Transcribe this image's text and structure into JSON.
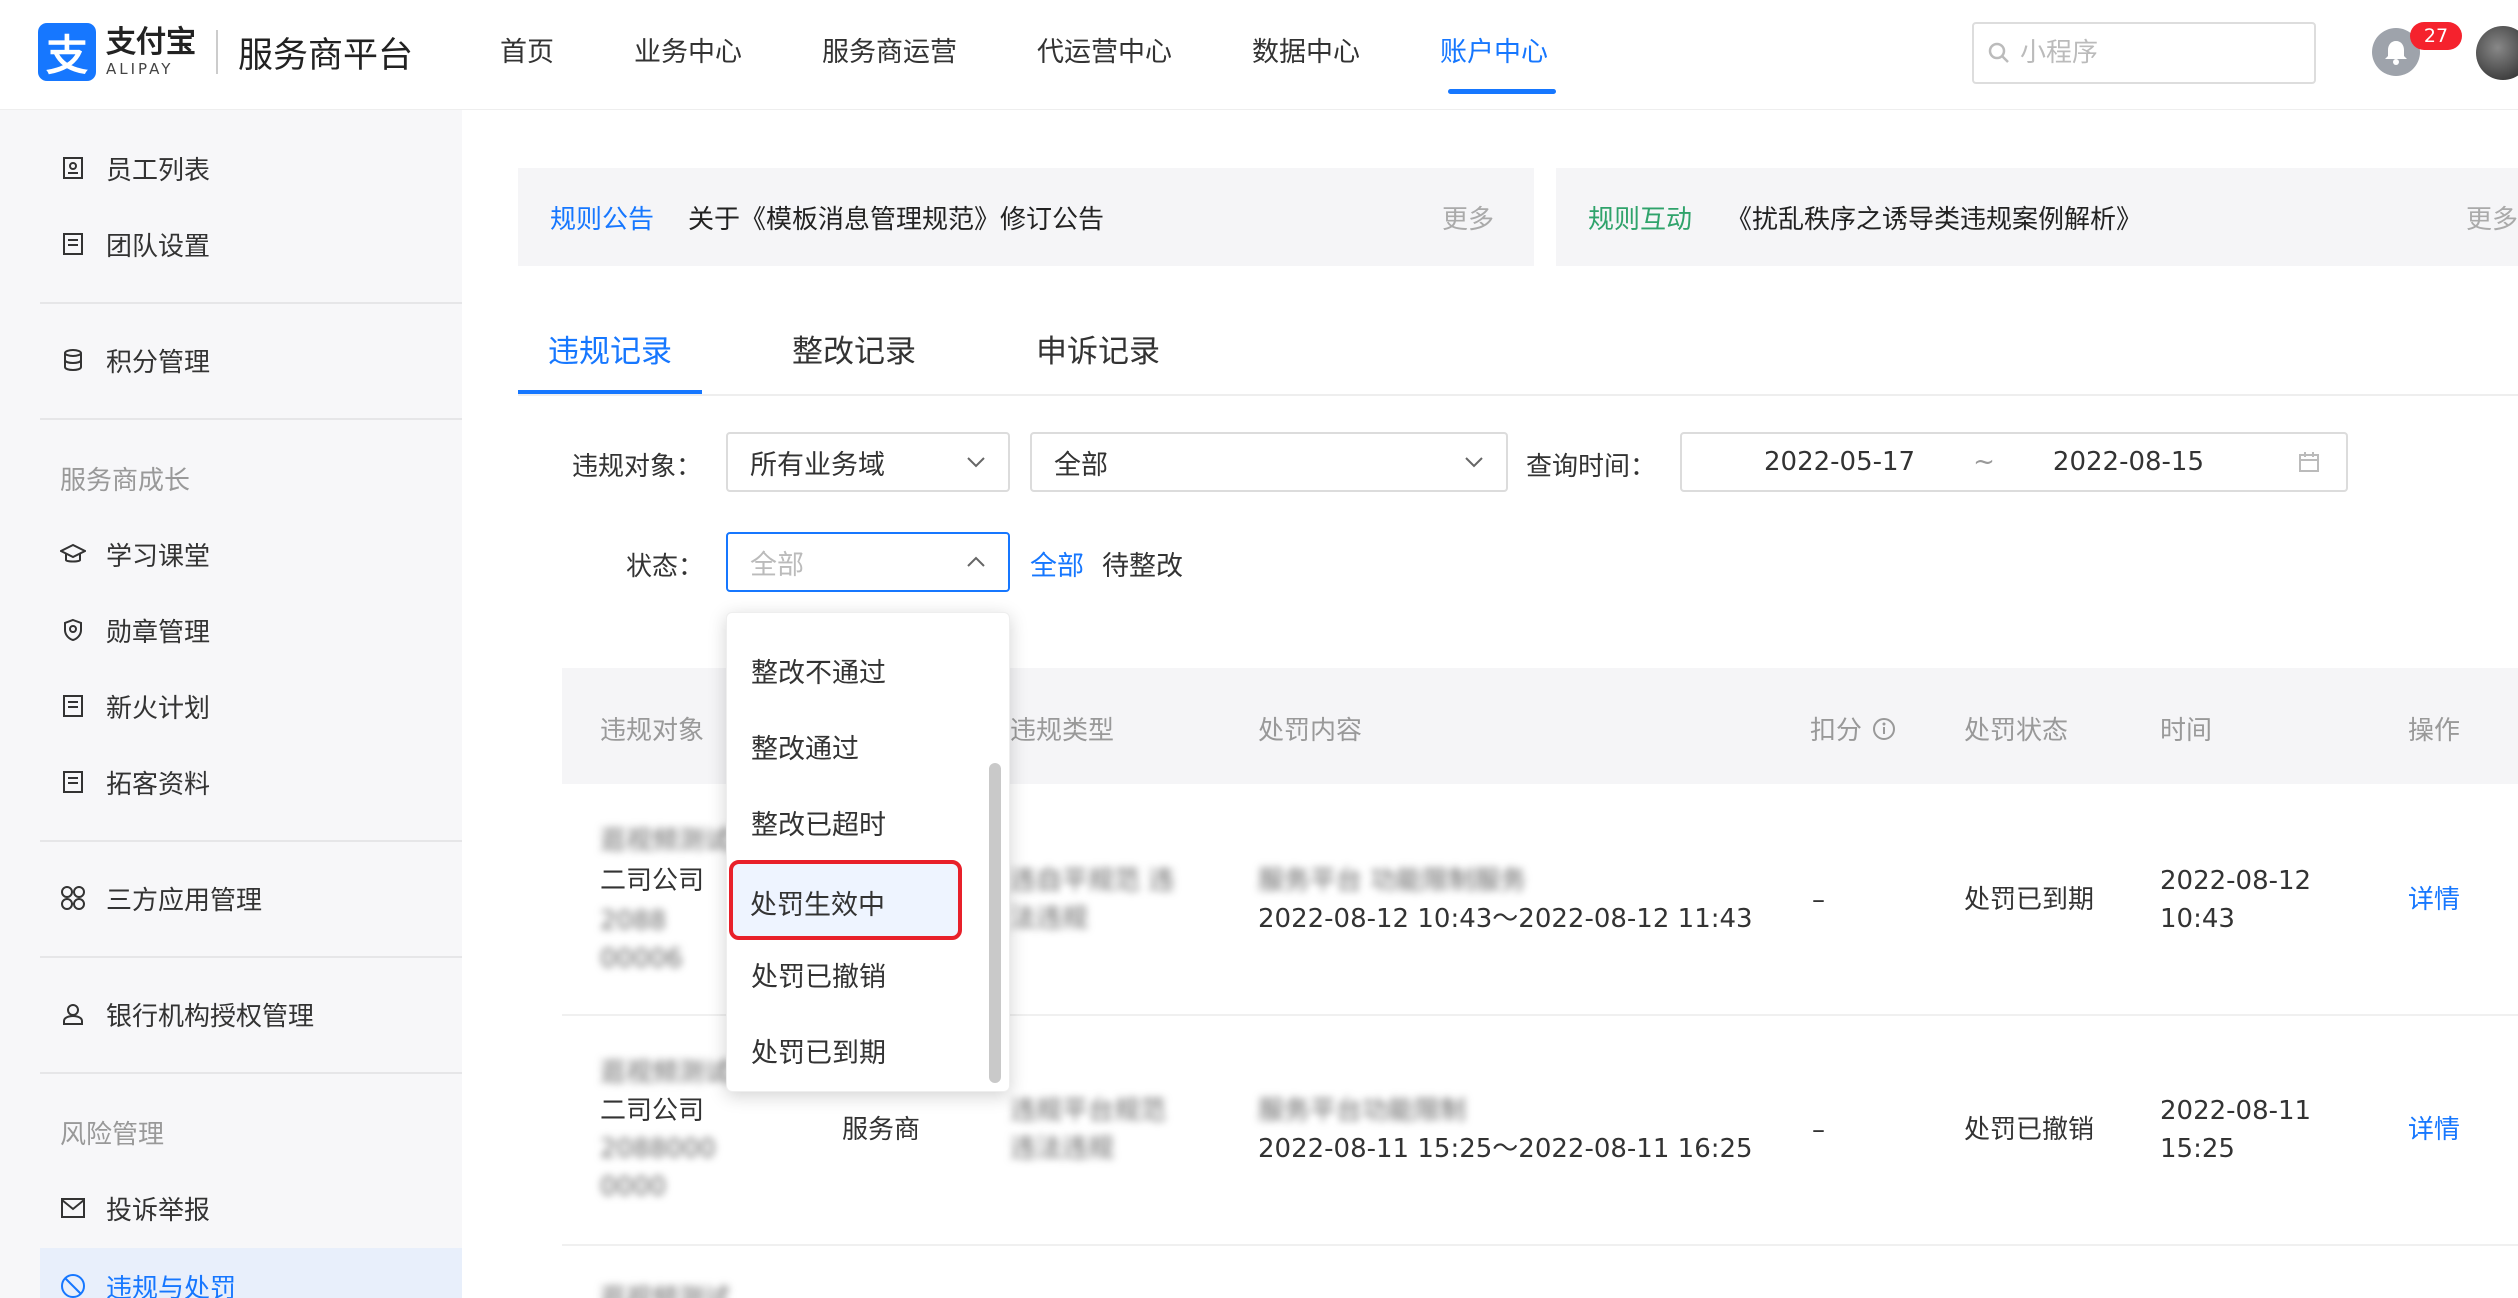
{
  "header": {
    "logo_cn": "支付宝",
    "logo_en": "ALIPAY",
    "platform_title": "服务商平台",
    "nav": [
      {
        "label": "首页"
      },
      {
        "label": "业务中心"
      },
      {
        "label": "服务商运营"
      },
      {
        "label": "代运营中心"
      },
      {
        "label": "数据中心"
      },
      {
        "label": "账户中心",
        "active": true
      }
    ],
    "search_placeholder": "小程序",
    "notification_count": "27"
  },
  "sidebar": {
    "items": [
      {
        "label": "员工列表",
        "icon": "id-card-icon"
      },
      {
        "label": "团队设置",
        "icon": "document-icon"
      },
      {
        "label": "积分管理",
        "icon": "database-icon"
      },
      {
        "label": "学习课堂",
        "icon": "graduation-cap-icon"
      },
      {
        "label": "勋章管理",
        "icon": "shield-icon"
      },
      {
        "label": "新火计划",
        "icon": "document-icon"
      },
      {
        "label": "拓客资料",
        "icon": "document-icon"
      },
      {
        "label": "三方应用管理",
        "icon": "apps-icon"
      },
      {
        "label": "银行机构授权管理",
        "icon": "user-icon"
      },
      {
        "label": "投诉举报",
        "icon": "mail-icon"
      },
      {
        "label": "违规与处罚",
        "icon": "forbidden-icon",
        "active": true
      }
    ],
    "groups": [
      "服务商成长",
      "风险管理"
    ]
  },
  "notices": [
    {
      "label": "规则公告",
      "text": "关于《模板消息管理规范》修订公告",
      "more": "更多",
      "color": "#1677ff"
    },
    {
      "label": "规则互动",
      "text": "《扰乱秩序之诱导类违规案例解析》",
      "more": "更多",
      "color": "#2fa36b"
    }
  ],
  "tabs": [
    {
      "label": "违规记录",
      "active": true
    },
    {
      "label": "整改记录"
    },
    {
      "label": "申诉记录"
    }
  ],
  "filters": {
    "target_label": "违规对象：",
    "target_value": "所有业务域",
    "target_sub_value": "全部",
    "time_label": "查询时间：",
    "date_start": "2022-05-17",
    "date_sep": "~",
    "date_end": "2022-08-15",
    "status_label": "状态：",
    "status_placeholder": "全部",
    "quick_all": "全部",
    "quick_pending": "待整改"
  },
  "dropdown": {
    "options": [
      "整改不通过",
      "整改通过",
      "整改已超时",
      "处罚生效中",
      "处罚已撤销",
      "处罚已到期"
    ],
    "highlighted": "处罚生效中"
  },
  "table": {
    "columns": [
      "违规对象",
      "违规类型",
      "处罚内容",
      "扣分",
      "处罚状态",
      "时间",
      "操作"
    ],
    "rows": [
      {
        "object_line1": "逛视频测试",
        "object_line2": "二司公司",
        "object_line3": "2088",
        "object_line4": "00006",
        "role": "",
        "type_line1": "违自平规范 违",
        "type_line2": "法违规",
        "penalty_line1": "服务平台 功能限制服务",
        "penalty_line2": "2022-08-12 10:43～2022-08-12 11:43",
        "score": "–",
        "status": "处罚已到期",
        "time_line1": "2022-08-12",
        "time_line2": "10:43",
        "action": "详情"
      },
      {
        "object_line1": "逛视频测试",
        "object_line2": "二司公司",
        "object_line3": "2088000",
        "object_line4": "0000",
        "role": "服务商",
        "type_line1": "违规平台规范",
        "type_line2": "违法违规",
        "penalty_line1": "服务平台功能限制",
        "penalty_line2": "2022-08-11 15:25～2022-08-11 16:25",
        "score": "–",
        "status": "处罚已撤销",
        "time_line1": "2022-08-11",
        "time_line2": "15:25",
        "action": "详情"
      }
    ],
    "partial_row_text": "逛视频测试"
  }
}
